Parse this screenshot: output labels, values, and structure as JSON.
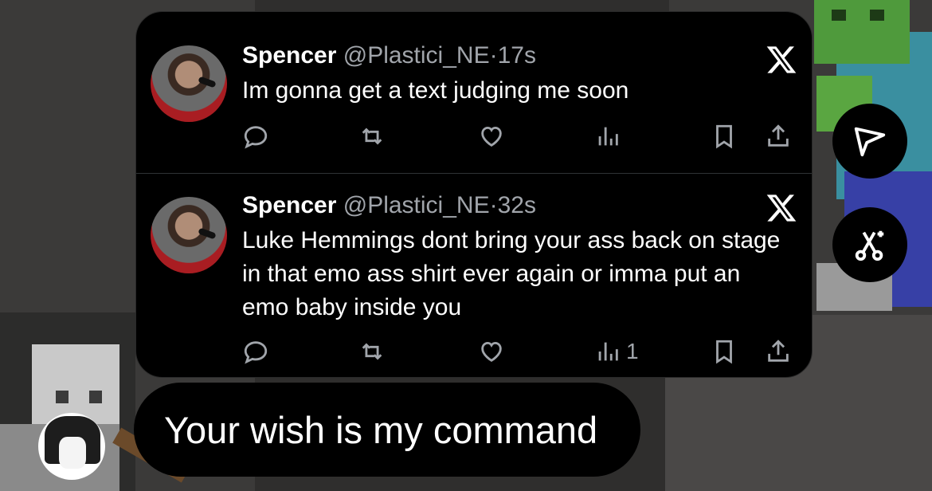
{
  "tweets": [
    {
      "name": "Spencer",
      "handle": "@Plastici_NE",
      "separator": "·",
      "time": "17s",
      "text": "Im gonna get a text judging me soon",
      "views": "",
      "platform_icon": "x-logo-icon"
    },
    {
      "name": "Spencer",
      "handle": "@Plastici_NE",
      "separator": "·",
      "time": "32s",
      "text": "Luke Hemmings dont bring your ass back on stage in that emo ass shirt ever again or imma put an emo baby inside you",
      "views": "1",
      "platform_icon": "x-logo-icon"
    }
  ],
  "reply": {
    "text": "Your wish is my command"
  },
  "side_actions": [
    {
      "icon": "send-icon"
    },
    {
      "icon": "ai-scissors-icon"
    }
  ],
  "colors": {
    "card_bg": "#000000",
    "muted_text": "#a1a5ab",
    "divider": "#2f3336"
  }
}
